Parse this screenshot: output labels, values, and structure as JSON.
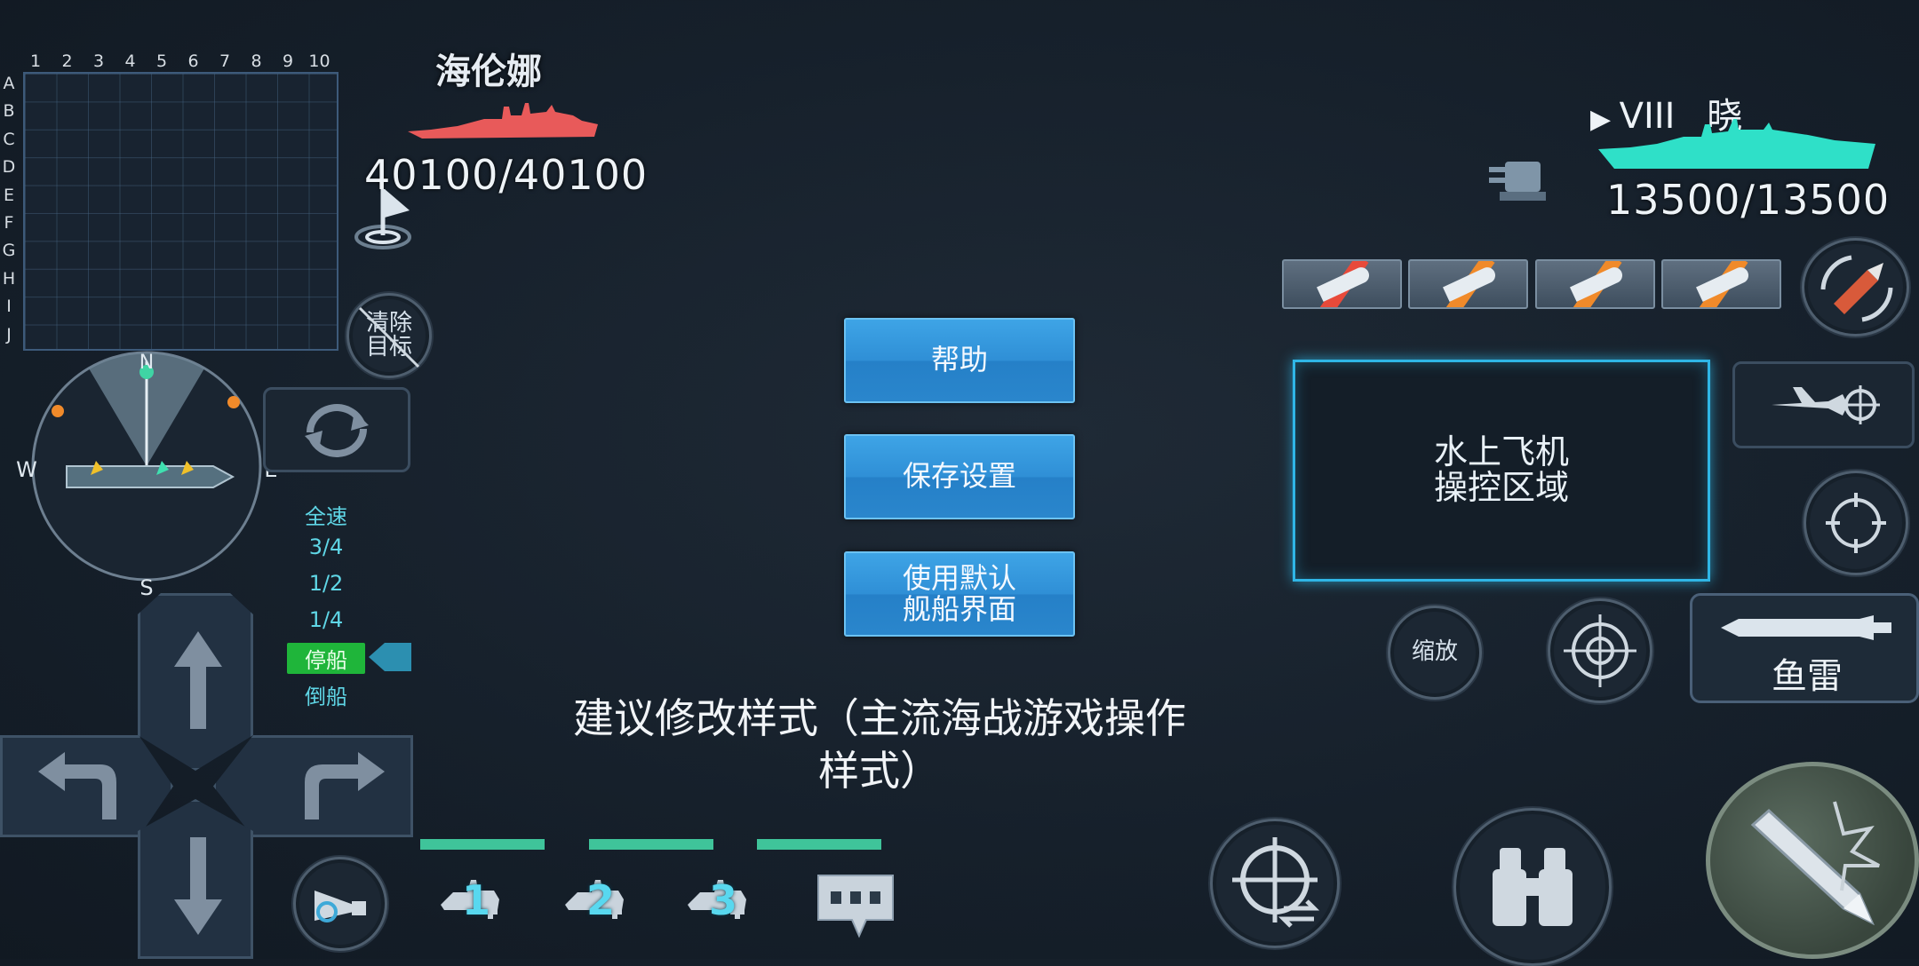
{
  "grid": {
    "columns": [
      "1",
      "2",
      "3",
      "4",
      "5",
      "6",
      "7",
      "8",
      "9",
      "10"
    ],
    "rows": [
      "A",
      "B",
      "C",
      "D",
      "E",
      "F",
      "G",
      "H",
      "I",
      "J"
    ]
  },
  "enemy": {
    "name": "海伦娜",
    "hp": "40100/40100",
    "color": "#e85a5a"
  },
  "player": {
    "tier": "VIII",
    "name": "晓",
    "hp": "13500/13500",
    "color": "#2fe0c8"
  },
  "clear_target_label": "清除\n目标",
  "compass": {
    "n": "N",
    "s": "S",
    "w": "W",
    "e": "E"
  },
  "speed": [
    "全速",
    "3/4",
    "1/2",
    "1/4",
    "停船",
    "倒船"
  ],
  "speed_active_index": 4,
  "menu": {
    "help": "帮助",
    "save": "保存设置",
    "default_ui": "使用默认\n舰船界面"
  },
  "caption": "建议修改样式（主流海战游戏操作\n样式）",
  "plane_area_label": "水上飞机\n操控区域",
  "zoom_label": "缩放",
  "torpedo_label": "鱼雷",
  "fleet": [
    "1",
    "2",
    "3"
  ],
  "ammo": [
    {
      "icon": "he-shell-icon",
      "stripe": "#e84a3a"
    },
    {
      "icon": "ap-shell-icon",
      "stripe": "#f08a2a"
    },
    {
      "icon": "cluster-shell-icon",
      "stripe": "#f08a2a"
    },
    {
      "icon": "sap-shell-icon",
      "stripe": "#f08a2a"
    }
  ]
}
